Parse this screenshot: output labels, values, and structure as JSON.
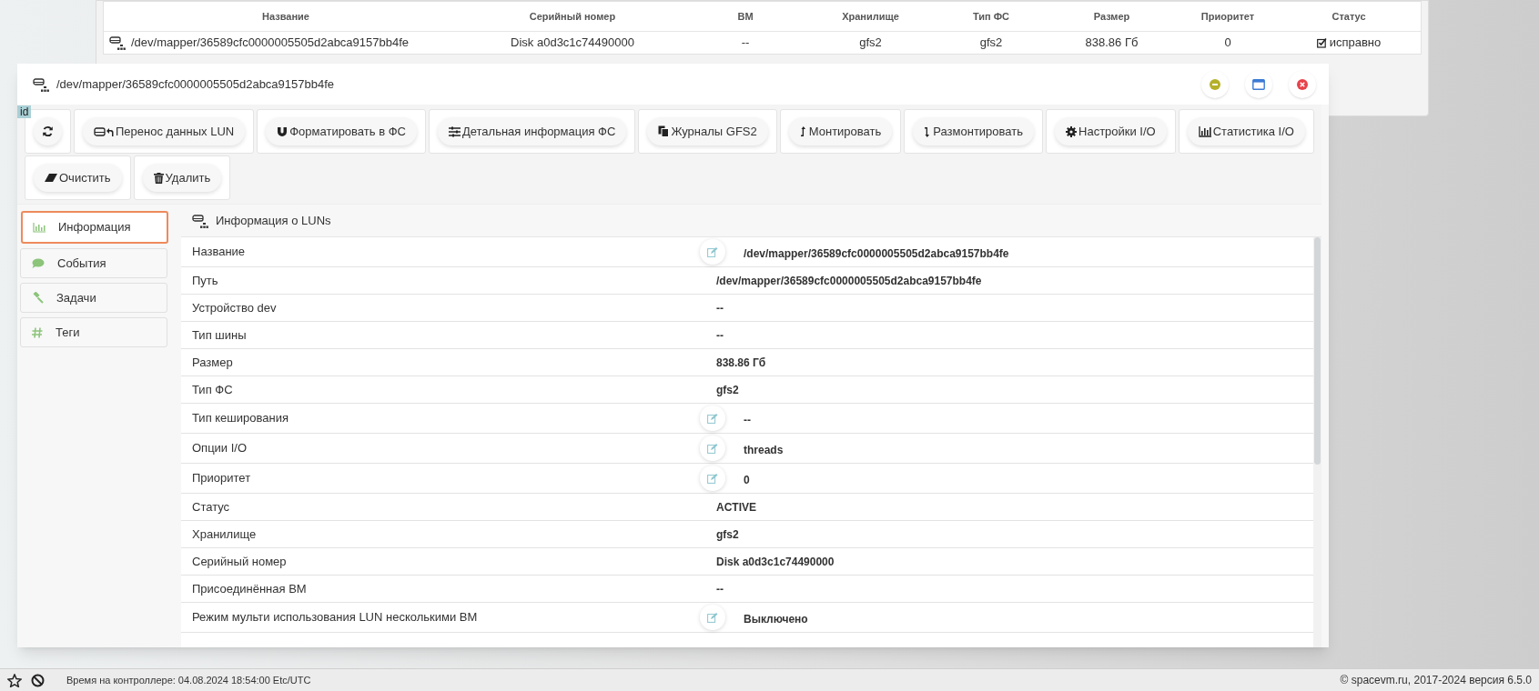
{
  "background_table": {
    "columns": [
      "Название",
      "Серийный номер",
      "ВМ",
      "Хранилище",
      "Тип ФС",
      "Размер",
      "Приоритет",
      "Статус"
    ],
    "rows": [
      {
        "cells": [
          "/dev/mapper/36589cfc0000005505d2abca9157bb4fe",
          "Disk a0d3c1c74490000",
          "--",
          "gfs2",
          "gfs2",
          "838.86 Гб",
          "0",
          "исправно"
        ],
        "checked": true
      }
    ]
  },
  "window": {
    "title": "/dev/mapper/36589cfc0000005505d2abca9157bb4fe",
    "badge": "id"
  },
  "toolbar": {
    "rows": [
      [
        {},
        {
          "label": "Перенос данных LUN"
        },
        {
          "label": "Форматировать в ФС"
        },
        {
          "label": "Детальная информация ФС"
        },
        {
          "label": "Журналы GFS2"
        },
        {
          "label": "Монтировать"
        },
        {
          "label": "Размонтировать"
        },
        {
          "label": "Настройки I/O"
        },
        {
          "label": "Статистика I/O"
        }
      ],
      [
        {
          "label": "Очистить"
        },
        {
          "label": "Удалить"
        }
      ]
    ]
  },
  "sidebar": {
    "items": [
      {
        "label": "Информация",
        "selected": true
      },
      {
        "label": "События",
        "selected": false
      },
      {
        "label": "Задачи",
        "selected": false
      },
      {
        "label": "Теги",
        "selected": false
      }
    ]
  },
  "panel": {
    "title": "Информация о LUNs",
    "rows": [
      {
        "label": "Название",
        "value": "/dev/mapper/36589cfc0000005505d2abca9157bb4fe",
        "editable": true
      },
      {
        "label": "Путь",
        "value": "/dev/mapper/36589cfc0000005505d2abca9157bb4fe",
        "editable": false
      },
      {
        "label": "Устройство dev",
        "value": "--",
        "editable": false
      },
      {
        "label": "Тип шины",
        "value": "--",
        "editable": false
      },
      {
        "label": "Размер",
        "value": "838.86 Гб",
        "editable": false
      },
      {
        "label": "Тип ФС",
        "value": "gfs2",
        "editable": false
      },
      {
        "label": "Тип кеширования",
        "value": "--",
        "editable": true
      },
      {
        "label": "Опции I/O",
        "value": "threads",
        "editable": true
      },
      {
        "label": "Приоритет",
        "value": "0",
        "editable": true
      },
      {
        "label": "Статус",
        "value": "ACTIVE",
        "editable": false
      },
      {
        "label": "Хранилище",
        "value": "gfs2",
        "editable": false
      },
      {
        "label": "Серийный номер",
        "value": "Disk a0d3c1c74490000",
        "editable": false
      },
      {
        "label": "Присоединённая ВМ",
        "value": "--",
        "editable": false
      },
      {
        "label": "Режим мульти использования LUN несколькими ВМ",
        "value": "Выключено",
        "editable": true
      }
    ]
  },
  "status_bar": {
    "clock": "Время на контроллере: 04.08.2024 18:54:00 Etc/UTC",
    "copyright": "© spacevm.ru, 2017-2024 версия 6.5.0"
  }
}
